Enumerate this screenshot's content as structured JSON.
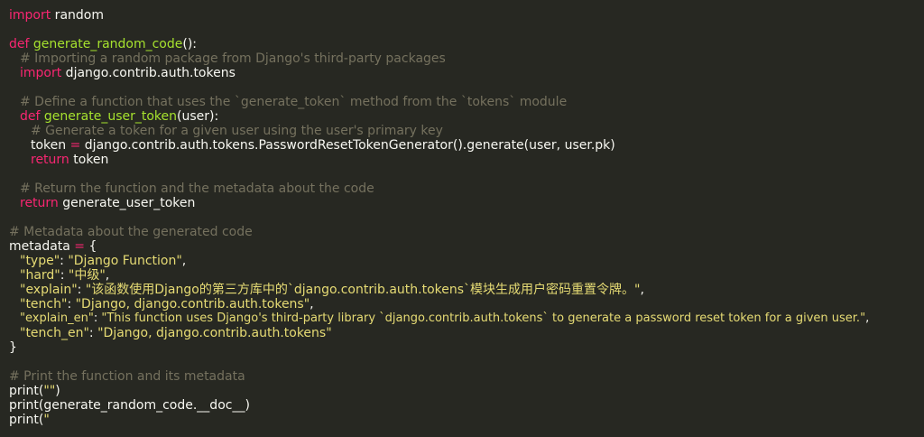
{
  "lines": {
    "l1": {
      "kw": "import",
      "rest": " random"
    },
    "l3": {
      "kw": "def",
      "name": "generate_random_code",
      "rest": "():"
    },
    "l4": "# Importing a random package from Django's third-party packages",
    "l5": {
      "kw": "import",
      "rest": " django.contrib.auth.tokens"
    },
    "l7": "# Define a function that uses the `generate_token` method from the `tokens` module",
    "l8": {
      "kw": "def",
      "name": "generate_user_token",
      "rest": "(user):"
    },
    "l9": "# Generate a token for a given user using the user's primary key",
    "l10": {
      "var": "token",
      "op": " = ",
      "rest": "django.contrib.auth.tokens.PasswordResetTokenGenerator().generate(user, user.pk)"
    },
    "l11": {
      "kw": "return",
      "rest": " token"
    },
    "l13": "# Return the function and the metadata about the code",
    "l14": {
      "kw": "return",
      "rest": " generate_user_token"
    },
    "l16": "# Metadata about the generated code",
    "l17": {
      "var": "metadata",
      "op": " = ",
      "rest": "{"
    },
    "l18": {
      "key": "\"type\"",
      "sep": ": ",
      "val": "\"Django Function\"",
      "end": ","
    },
    "l19": {
      "key": "\"hard\"",
      "sep": ": ",
      "val": "\"中级\"",
      "end": ","
    },
    "l20": {
      "key": "\"explain\"",
      "sep": ": ",
      "val": "\"该函数使用Django的第三方库中的`django.contrib.auth.tokens`模块生成用户密码重置令牌。\"",
      "end": ","
    },
    "l21": {
      "key": "\"tench\"",
      "sep": ": ",
      "val": "\"Django, django.contrib.auth.tokens\"",
      "end": ","
    },
    "l22": {
      "key": "\"explain_en\"",
      "sep": ": ",
      "val": "\"This function uses Django's third-party library `django.contrib.auth.tokens` to generate a password reset token for a given user.\"",
      "end": ","
    },
    "l23": {
      "key": "\"tench_en\"",
      "sep": ": ",
      "val": "\"Django, django.contrib.auth.tokens\"",
      "end": ""
    },
    "l24": "}",
    "l26": "# Print the function and its metadata",
    "l27": {
      "fn": "print",
      "open": "(",
      "val": "\"\"",
      "close": ")"
    },
    "l28": {
      "fn": "print",
      "rest": "(generate_random_code.__doc__)"
    },
    "l29": {
      "fn": "print",
      "open": "(",
      "val": "\""
    }
  }
}
